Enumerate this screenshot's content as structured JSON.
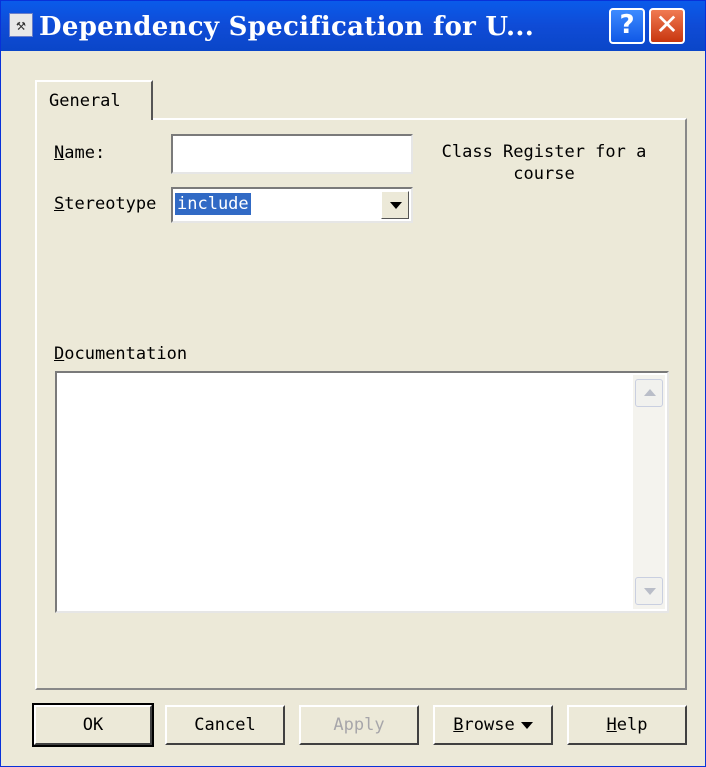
{
  "window": {
    "title": "Dependency Specification for U...",
    "help_glyph": "?",
    "close_glyph": "✕",
    "icon": "spec-window-icon"
  },
  "tabs": [
    {
      "label": "General",
      "selected": true
    }
  ],
  "fields": {
    "name": {
      "label_key": "N",
      "label_rest": "ame:",
      "value": ""
    },
    "class_text": "Class Register for a course",
    "stereotype": {
      "label_key": "S",
      "label_rest": "tereotype",
      "value": "include"
    },
    "documentation": {
      "label_key": "D",
      "label_rest": "ocumentation",
      "value": ""
    }
  },
  "buttons": {
    "ok": "OK",
    "cancel": "Cancel",
    "apply": "Apply",
    "browse_key": "B",
    "browse_rest": "rowse",
    "help_key": "H",
    "help_rest": "elp"
  },
  "colors": {
    "titlebar": "#0a5bea",
    "selection": "#316ac5",
    "dialog_bg": "#ece9d8"
  }
}
